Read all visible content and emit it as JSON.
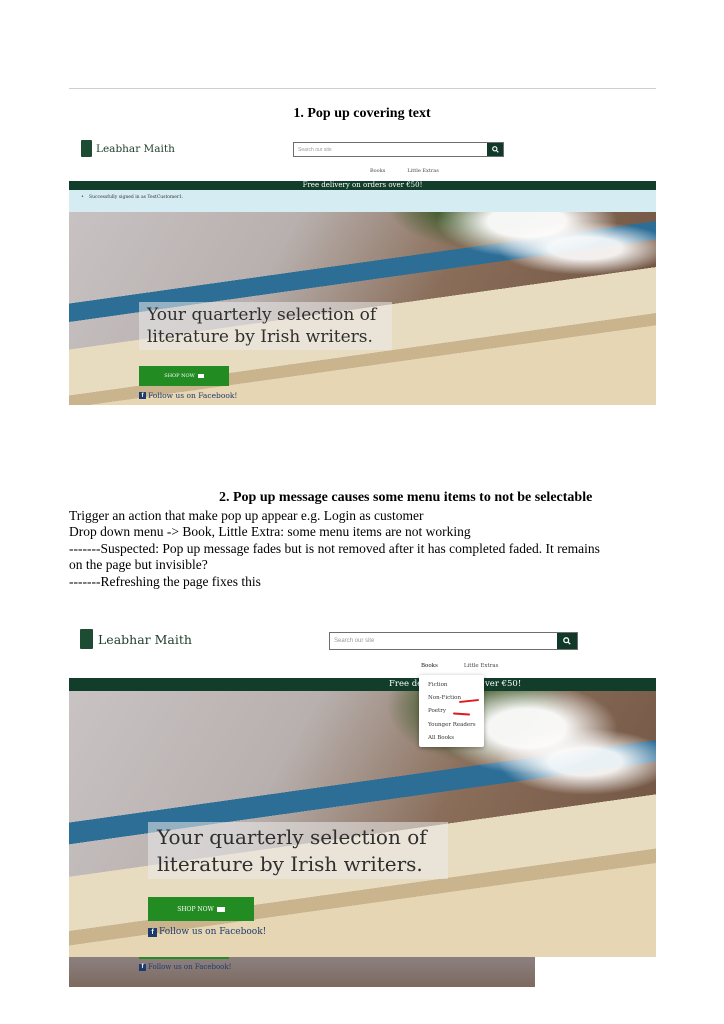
{
  "section1": {
    "heading": "1. Pop up covering text",
    "screenshot": {
      "brand": "Leabhar Maith",
      "search_placeholder": "Search our site",
      "nav": [
        "Books",
        "Little Extras"
      ],
      "banner": "Free delivery on orders over €50!",
      "alert": "Successfully signed in as TestCustomer1.",
      "tagline_line1": "Your quarterly selection of",
      "tagline_line2": "literature by Irish writers.",
      "shop_button": "SHOP NOW",
      "facebook": "Follow us on Facebook!"
    }
  },
  "section2": {
    "heading": "2.   Pop up message causes some menu items to not be selectable",
    "lines": [
      "Trigger an action that make pop up appear e.g. Login as customer",
      "Drop down menu -> Book, Little Extra: some menu items are not working",
      "-------Suspected: Pop up message fades but is not removed after it has completed faded. It remains",
      "on the page but invisible?",
      "-------Refreshing the page fixes this"
    ],
    "screenshot": {
      "brand": "Leabhar Maith",
      "search_placeholder": "Search our site",
      "nav": [
        "Books",
        "Little Extras"
      ],
      "banner_left": "Free de",
      "banner_right": "ver €50!",
      "dropdown": [
        "Fiction",
        "Non-Fiction",
        "Poetry",
        "Younger Readers",
        "All Books"
      ],
      "tagline_line1": "Your quarterly selection of",
      "tagline_line2": "literature by Irish writers.",
      "shop_button": "SHOP NOW",
      "facebook": "Follow us on Facebook!",
      "facebook_repeat": "Follow us on Facebook!"
    }
  },
  "colors": {
    "brand_green": "#123d2b",
    "shop_green": "#228b22",
    "alert_bg": "#d4ecf2",
    "annotation_red": "#e0191e"
  },
  "icons": [
    "book-logo-icon",
    "search-icon",
    "card-icon",
    "facebook-icon"
  ]
}
